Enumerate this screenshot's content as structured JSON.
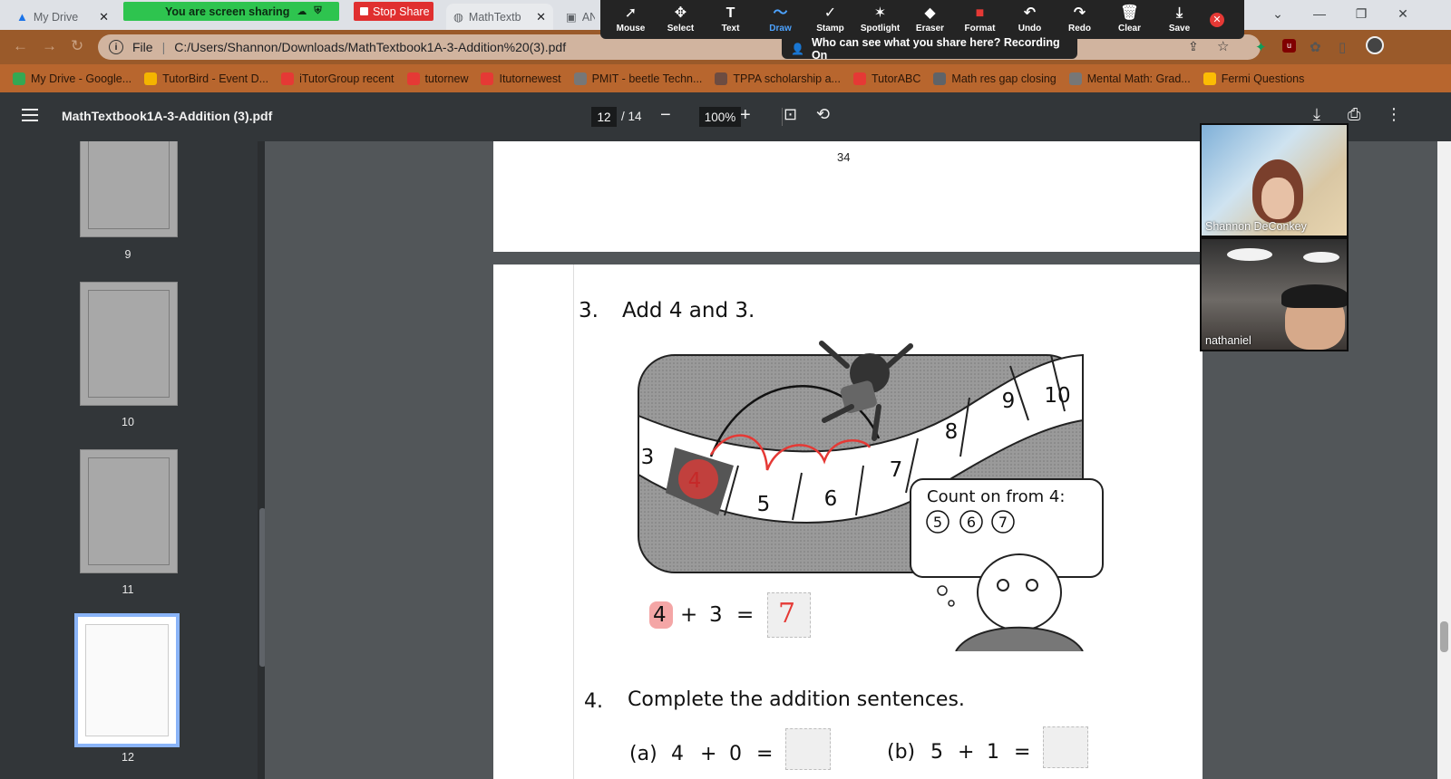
{
  "browser": {
    "tabs": [
      {
        "label": "My Drive"
      },
      {
        "label": "MathTextb"
      },
      {
        "label": "AN"
      }
    ],
    "address": {
      "scheme_label": "File",
      "url": "C:/Users/Shannon/Downloads/MathTextbook1A-3-Addition%20(3).pdf"
    },
    "bookmarks": [
      {
        "label": "My Drive - Google...",
        "color": "#34a853"
      },
      {
        "label": "TutorBird - Event D...",
        "color": "#f4b400"
      },
      {
        "label": "iTutorGroup recent",
        "color": "#e53935"
      },
      {
        "label": "tutornew",
        "color": "#e53935"
      },
      {
        "label": "Itutornewest",
        "color": "#e53935"
      },
      {
        "label": "PMIT - beetle Techn...",
        "color": "#777777"
      },
      {
        "label": "TPPA scholarship a...",
        "color": "#6d4c41"
      },
      {
        "label": "TutorABC",
        "color": "#e53935"
      },
      {
        "label": "Math res gap closing",
        "color": "#5f6368"
      },
      {
        "label": "Mental Math: Grad...",
        "color": "#777777"
      },
      {
        "label": "Fermi Questions",
        "color": "#fbbc04"
      }
    ]
  },
  "zoom_share": {
    "sharing_label": "You are screen sharing",
    "stop_label": "Stop Share",
    "tools": [
      {
        "label": "Mouse",
        "icon": "pointer-icon",
        "glyph": "➚"
      },
      {
        "label": "Select",
        "icon": "move-icon",
        "glyph": "✥"
      },
      {
        "label": "Text",
        "icon": "text-icon",
        "glyph": "T"
      },
      {
        "label": "Draw",
        "icon": "draw-icon",
        "glyph": "〜"
      },
      {
        "label": "Stamp",
        "icon": "stamp-icon",
        "glyph": "✓"
      },
      {
        "label": "Spotlight",
        "icon": "spotlight-icon",
        "glyph": "✶"
      },
      {
        "label": "Eraser",
        "icon": "eraser-icon",
        "glyph": "◆"
      },
      {
        "label": "Format",
        "icon": "format-icon",
        "glyph": "■"
      },
      {
        "label": "Undo",
        "icon": "undo-icon",
        "glyph": "↶"
      },
      {
        "label": "Redo",
        "icon": "redo-icon",
        "glyph": "↷"
      },
      {
        "label": "Clear",
        "icon": "trash-icon",
        "glyph": "🗑"
      },
      {
        "label": "Save",
        "icon": "save-icon",
        "glyph": "⤓"
      }
    ],
    "recording_notice": "Who can see what you share here? Recording On"
  },
  "pdf": {
    "filename": "MathTextbook1A-3-Addition (3).pdf",
    "current_page": "12",
    "total_pages": "/ 14",
    "zoom": "100%",
    "thumbnails": [
      {
        "label": "9"
      },
      {
        "label": "10"
      },
      {
        "label": "11"
      },
      {
        "label": "12"
      }
    ],
    "page_number_above": "34",
    "q3": {
      "number": "3.",
      "title": "Add 4 and 3.",
      "track_numbers": [
        "3",
        "4",
        "5",
        "6",
        "7",
        "8",
        "9",
        "10"
      ],
      "bubble_title": "Count on from 4:",
      "bubble_counts": [
        "5",
        "6",
        "7"
      ],
      "sentence": {
        "a": "4",
        "op": "+",
        "b": "3",
        "eq": "=",
        "answer": "7"
      }
    },
    "q4": {
      "number": "4.",
      "title": "Complete the addition sentences.",
      "items": [
        {
          "label": "(a)",
          "a": "4",
          "op": "+",
          "b": "0",
          "eq": "="
        },
        {
          "label": "(b)",
          "a": "5",
          "op": "+",
          "b": "1",
          "eq": "="
        }
      ]
    }
  },
  "participants": [
    {
      "name": "Shannon DeConkey"
    },
    {
      "name": "nathaniel"
    }
  ],
  "colors": {
    "annotation_red": "#e53935",
    "share_green": "#2ec44f",
    "stop_red": "#e02f2f",
    "highlight_blue": "#8ab4f8"
  }
}
